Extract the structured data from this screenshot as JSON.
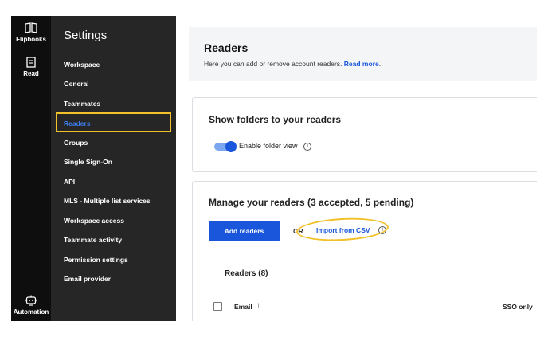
{
  "iconbar": {
    "items": [
      {
        "label": "Flipbooks",
        "icon": "book-icon"
      },
      {
        "label": "Read",
        "icon": "document-icon"
      },
      {
        "label": "Automation",
        "icon": "robot-icon"
      }
    ]
  },
  "sidebar": {
    "title": "Settings",
    "items": [
      {
        "label": "Workspace"
      },
      {
        "label": "General"
      },
      {
        "label": "Teammates"
      },
      {
        "label": "Readers",
        "active": true
      },
      {
        "label": "Groups"
      },
      {
        "label": "Single Sign-On"
      },
      {
        "label": "API"
      },
      {
        "label": "MLS - Multiple list services"
      },
      {
        "label": "Workspace access"
      },
      {
        "label": "Teammate activity"
      },
      {
        "label": "Permission settings"
      },
      {
        "label": "Email provider"
      }
    ]
  },
  "header": {
    "title": "Readers",
    "description": "Here you can add or remove account readers.",
    "link": "Read more"
  },
  "folders_card": {
    "title": "Show folders to your readers",
    "toggle_label": "Enable folder view",
    "toggle_on": true
  },
  "manage_card": {
    "title": "Manage your readers (3 accepted, 5 pending)",
    "add_button": "Add readers",
    "or_text": "OR",
    "import_link": "Import from CSV",
    "readers_heading": "Readers (8)",
    "columns": {
      "email": "Email",
      "sso": "SSO only"
    }
  },
  "colors": {
    "accent": "#1a56db",
    "highlight": "#f2c029",
    "sidebar_bg": "#262626",
    "iconbar_bg": "#0e0e0e"
  }
}
